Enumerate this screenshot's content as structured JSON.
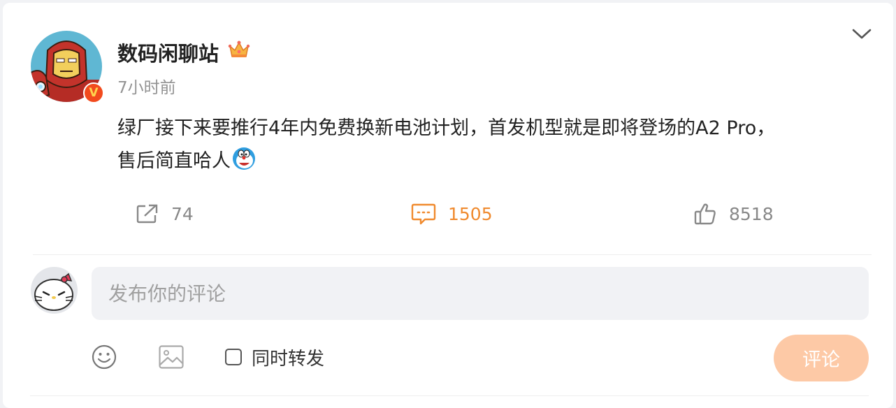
{
  "post": {
    "author": "数码闲聊站",
    "verified_mark": "V",
    "time": "7小时前",
    "text_line1": "绿厂接下来要推行4年内免费换新电池计划，首发机型就是即将登场的A2 Pro，",
    "text_line2": "售后简直哈人"
  },
  "actions": {
    "repost_count": "74",
    "comment_count": "1505",
    "like_count": "8518"
  },
  "composer": {
    "placeholder": "发布你的评论",
    "forward_label": "同时转发",
    "submit_label": "评论"
  },
  "icons": {
    "collapse": "chevron-down-icon",
    "crown": "crown-badge-icon",
    "verified": "verified-badge-icon",
    "repost": "share-icon",
    "comment": "comment-icon",
    "like": "thumbs-up-icon",
    "emoji": "smiley-icon",
    "image": "image-icon"
  },
  "colors": {
    "accent_orange": "#f08a2e",
    "submit_disabled": "#fdc9a6",
    "verified_red": "#f24a1d"
  }
}
